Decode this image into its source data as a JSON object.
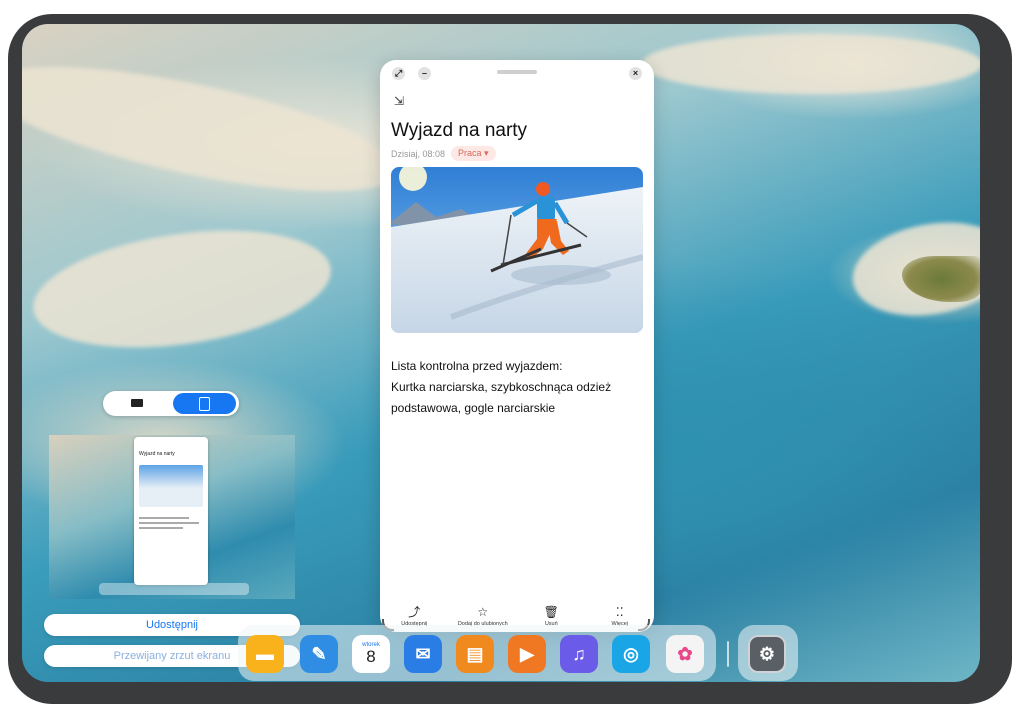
{
  "note": {
    "title": "Wyjazd na narty",
    "date": "Dzisiaj, 08:08",
    "category": "Praca",
    "body_line1": "Lista kontrolna przed wyjazdem:",
    "body_line2": "Kurtka narciarska, szybkoschnąca odzież podstawowa, gogle narciarskie",
    "toolbar": [
      {
        "label": "Udostępnij",
        "icon": "share-icon"
      },
      {
        "label": "Dodaj do ulubionych",
        "icon": "star-icon"
      },
      {
        "label": "Usuń",
        "icon": "trash-icon"
      },
      {
        "label": "Więcej",
        "icon": "more-icon"
      }
    ]
  },
  "thumbnail": {
    "title": "Wyjazd na narty"
  },
  "screenshot_actions": {
    "share_label": "Udostępnij",
    "scroll_label": "Przewijany zrzut ekranu"
  },
  "dock": {
    "calendar_day_name": "wtorek",
    "calendar_day_number": "8",
    "apps": [
      "files-icon",
      "notes-icon",
      "calendar-icon",
      "mail-icon",
      "office-icon",
      "video-icon",
      "music-icon",
      "browser-icon",
      "gallery-icon",
      "settings-icon"
    ]
  },
  "colors": {
    "accent": "#1777f2",
    "tag_bg": "#fde8e5",
    "tag_text": "#d66b5b"
  }
}
